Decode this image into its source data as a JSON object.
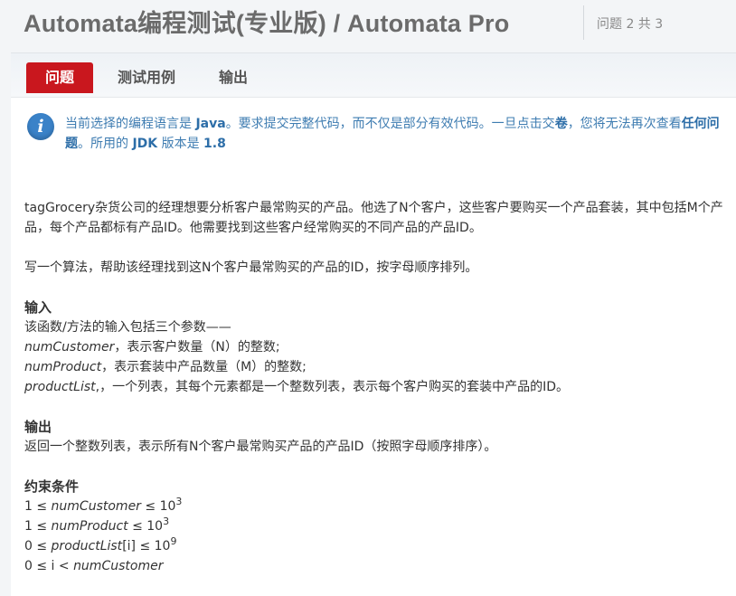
{
  "header": {
    "title": "Automata编程测试(专业版) / Automata Pro",
    "counter": "问题 2 共 3"
  },
  "tabs": [
    {
      "label": "问题",
      "active": true
    },
    {
      "label": "测试用例",
      "active": false
    },
    {
      "label": "输出",
      "active": false
    }
  ],
  "notice": {
    "icon": "info-icon",
    "t1": "当前选择的编程语言是 ",
    "language": "Java",
    "t2": "。要求提交完整代码，而不仅是部分有效代码。一旦点击交",
    "submit_word": "卷",
    "t3": "，您将无法再次查看",
    "any_question": "任何问题",
    "t4": "。所用的 ",
    "jdk": "JDK",
    "t5": " 版本是 ",
    "version": "1.8"
  },
  "problem": {
    "para1": "tagGrocery杂货公司的经理想要分析客户最常购买的产品。他选了N个客户，这些客户要购买一个产品套装，其中包括M个产品，每个产品都标有产品ID。他需要找到这些客户经常购买的不同产品的产品ID。",
    "para2": "写一个算法，帮助该经理找到这N个客户最常购买的产品的ID，按字母顺序排列。",
    "input_heading": "输入",
    "input_intro": "该函数/方法的输入包括三个参数——",
    "param1_name": "numCustomer",
    "param1_desc": "，表示客户数量（N）的整数;",
    "param2_name": "numProduct",
    "param2_desc": "，表示套装中产品数量（M）的整数;",
    "param3_name": "productList",
    "param3_desc": ",，一个列表，其每个元素都是一个整数列表，表示每个客户购买的套装中产品的ID。",
    "output_heading": "输出",
    "output_text": "返回一个整数列表，表示所有N个客户最常购买产品的产品ID（按照字母顺序排序）。",
    "constraints_heading": "约束条件",
    "c1_pre": "1 ≤ ",
    "c1_var": "numCustomer",
    "c1_post": " ≤ 10",
    "c1_exp": "3",
    "c2_pre": "1 ≤ ",
    "c2_var": "numProduct",
    "c2_post": " ≤ 10",
    "c2_exp": "3",
    "c3_pre": "0 ≤ ",
    "c3_var": "productList",
    "c3_post": "[i] ≤ 10",
    "c3_exp": "9",
    "c4_pre": "0 ≤ i < ",
    "c4_var": "numCustomer"
  }
}
